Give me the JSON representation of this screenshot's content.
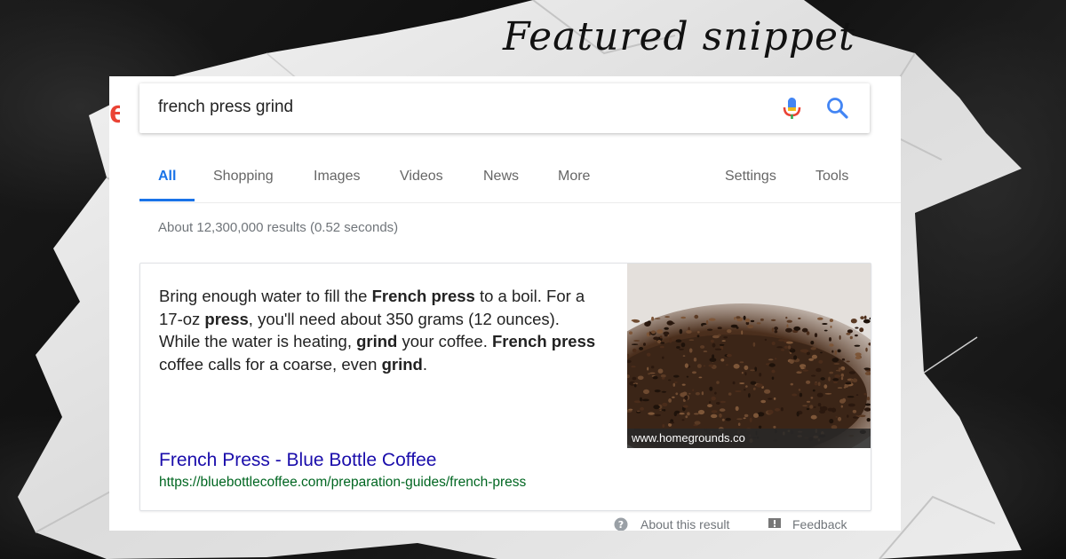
{
  "overlay_title": "Featured snippet",
  "logo_fragment": "e",
  "search": {
    "query": "french press grind"
  },
  "tabs": [
    {
      "label": "All",
      "active": true
    },
    {
      "label": "Shopping"
    },
    {
      "label": "Images"
    },
    {
      "label": "Videos"
    },
    {
      "label": "News"
    },
    {
      "label": "More"
    },
    {
      "label": "Settings"
    },
    {
      "label": "Tools"
    }
  ],
  "stats": "About 12,300,000 results (0.52 seconds)",
  "snippet": {
    "text_parts": [
      {
        "t": "Bring enough water to fill the ",
        "b": false
      },
      {
        "t": "French press",
        "b": true
      },
      {
        "t": " to a boil. For a 17-oz ",
        "b": false
      },
      {
        "t": "press",
        "b": true
      },
      {
        "t": ", you'll need about 350 grams (12 ounces). While the water is heating, ",
        "b": false
      },
      {
        "t": "grind",
        "b": true
      },
      {
        "t": " your coffee. ",
        "b": false
      },
      {
        "t": "French press",
        "b": true
      },
      {
        "t": " coffee calls for a coarse, even ",
        "b": false
      },
      {
        "t": "grind",
        "b": true
      },
      {
        "t": ".",
        "b": false
      }
    ],
    "image_caption": "www.homegrounds.co",
    "result_title": "French Press - Blue Bottle Coffee",
    "result_url": "https://bluebottlecoffee.com/preparation-guides/french-press"
  },
  "footer": {
    "about_label": "About this result",
    "feedback_label": "Feedback"
  },
  "colors": {
    "accent_blue": "#1a73e8",
    "link_blue": "#1a0dab",
    "url_green": "#006621",
    "logo_red": "#ea4335"
  },
  "icons": [
    "microphone-icon",
    "search-icon",
    "question-circle-icon",
    "feedback-flag-icon",
    "coffee-grounds-image"
  ]
}
